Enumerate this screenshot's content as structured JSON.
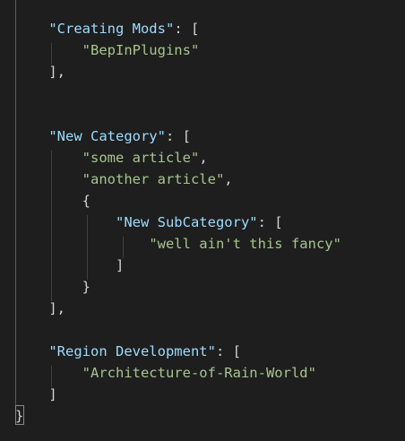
{
  "code": {
    "lines": [
      {
        "indent": "    ",
        "key": "\"Creating Mods\"",
        "after": ": ["
      },
      {
        "indent": "        ",
        "value": "\"BepInPlugins\""
      },
      {
        "indent": "    ",
        "text": "],"
      },
      {
        "indent": "",
        "text": ""
      },
      {
        "indent": "",
        "text": ""
      },
      {
        "indent": "    ",
        "key": "\"New Category\"",
        "after": ": ["
      },
      {
        "indent": "        ",
        "value": "\"some article\"",
        "after": ","
      },
      {
        "indent": "        ",
        "value": "\"another article\"",
        "after": ","
      },
      {
        "indent": "        ",
        "text": "{"
      },
      {
        "indent": "            ",
        "key": "\"New SubCategory\"",
        "after": ": ["
      },
      {
        "indent": "                ",
        "value": "\"well ain't this fancy\""
      },
      {
        "indent": "            ",
        "text": "]"
      },
      {
        "indent": "        ",
        "text": "}"
      },
      {
        "indent": "    ",
        "text": "],"
      },
      {
        "indent": "",
        "text": ""
      },
      {
        "indent": "    ",
        "key": "\"Region Development\"",
        "after": ": ["
      },
      {
        "indent": "        ",
        "value": "\"Architecture-of-Rain-World\""
      },
      {
        "indent": "    ",
        "text": "]"
      },
      {
        "indent": "",
        "text": "}"
      }
    ]
  },
  "colors": {
    "background": "#1e1e1e",
    "key": "#9cdcfe",
    "string_value": "#b5cea8",
    "punctuation": "#d4d4d4"
  }
}
